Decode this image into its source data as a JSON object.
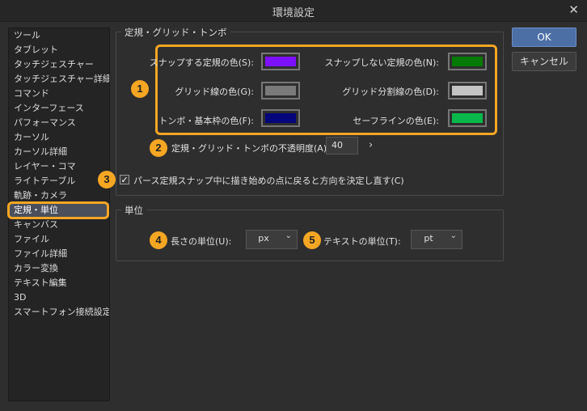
{
  "window": {
    "title": "環境設定",
    "close_glyph": "✕"
  },
  "sidebar": {
    "items": [
      "ツール",
      "タブレット",
      "タッチジェスチャー",
      "タッチジェスチャー詳細",
      "コマンド",
      "インターフェース",
      "パフォーマンス",
      "カーソル",
      "カーソル詳細",
      "レイヤー・コマ",
      "ライトテーブル",
      "軌跡・カメラ",
      "定規・単位",
      "キャンバス",
      "ファイル",
      "ファイル詳細",
      "カラー変換",
      "テキスト編集",
      "3D",
      "スマートフォン接続設定"
    ],
    "selected_index": 12
  },
  "ruler_group": {
    "title": "定規・グリッド・トンボ",
    "colors": {
      "snap": {
        "label": "スナップする定規の色(S):",
        "color": "#7d10ff"
      },
      "nosnap": {
        "label": "スナップしない定規の色(N):",
        "color": "#037a03"
      },
      "grid": {
        "label": "グリッド線の色(G):",
        "color": "#7a7a7a"
      },
      "grid_div": {
        "label": "グリッド分割線の色(D):",
        "color": "#c4c4c4"
      },
      "tombo": {
        "label": "トンボ・基本枠の色(F):",
        "color": "#05057c"
      },
      "safe": {
        "label": "セーフラインの色(E):",
        "color": "#08b84a"
      }
    },
    "opacity": {
      "label": "定規・グリッド・トンボの不透明度(A):",
      "value": "40",
      "arrow": "›"
    },
    "perspective": {
      "label": "パース定規スナップ中に描き始めの点に戻ると方向を決定し直す(C)",
      "checked": true,
      "check_glyph": "✓"
    }
  },
  "unit_group": {
    "title": "単位",
    "length": {
      "label": "長さの単位(U):",
      "value": "px"
    },
    "text": {
      "label": "テキストの単位(T):",
      "value": "pt"
    },
    "chevron": "⌄"
  },
  "buttons": {
    "ok": "OK",
    "cancel": "キャンセル"
  },
  "badges": [
    "1",
    "2",
    "3",
    "4",
    "5"
  ],
  "accent_color": "#f5a623"
}
